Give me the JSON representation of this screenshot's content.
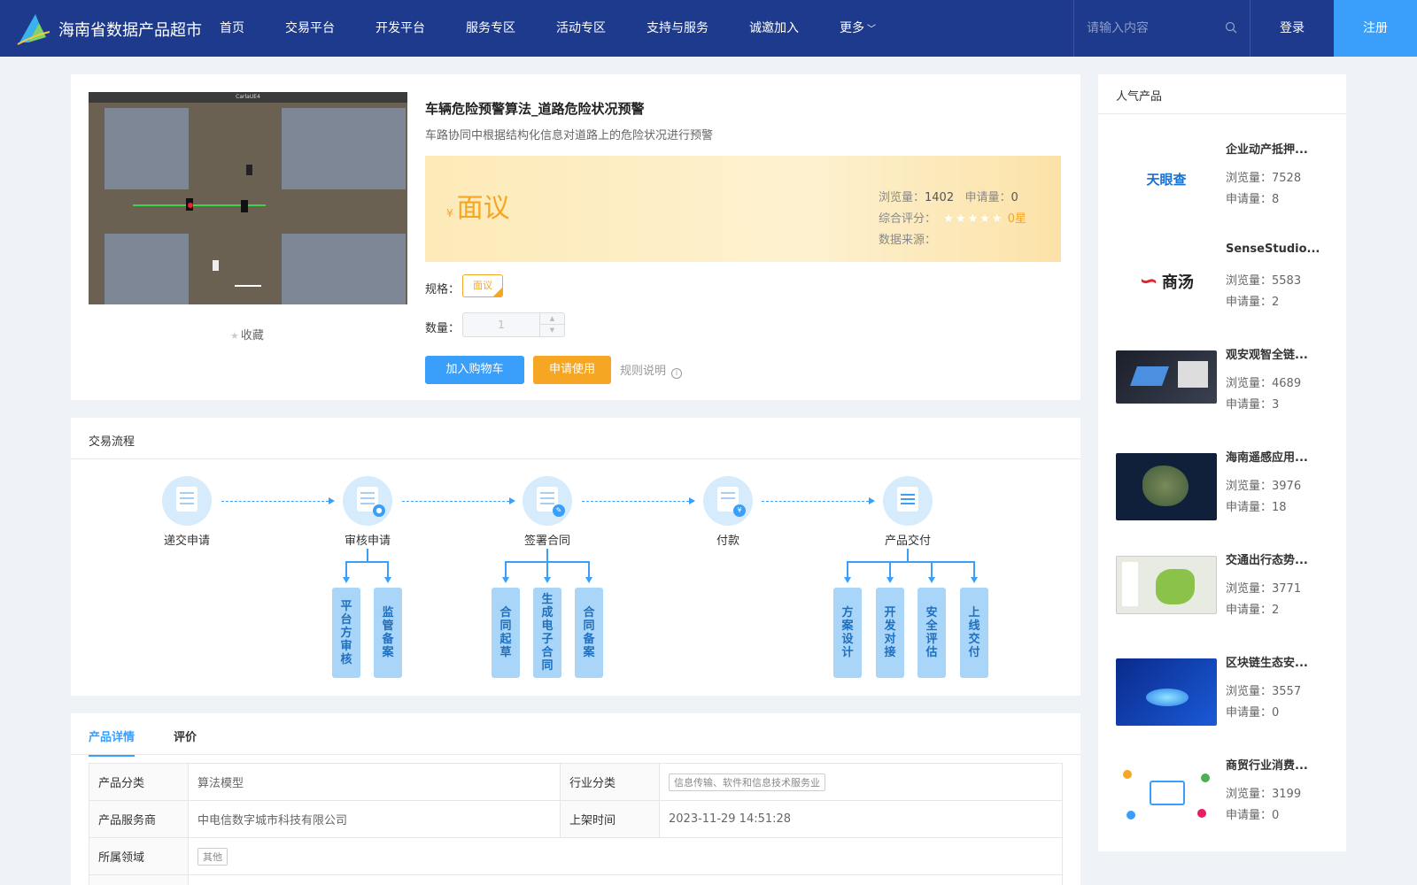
{
  "header": {
    "site_title": "海南省数据产品超市",
    "nav": [
      "首页",
      "交易平台",
      "开发平台",
      "服务专区",
      "活动专区",
      "支持与服务",
      "诚邀加入",
      "更多"
    ],
    "search_placeholder": "请输入内容",
    "login": "登录",
    "register": "注册"
  },
  "product": {
    "title": "车辆危险预警算法_道路危险状况预警",
    "subtitle": "车路协同中根据结构化信息对道路上的危险状况进行预警",
    "currency": "¥",
    "price": "面议",
    "views_label": "浏览量：",
    "views": "1402",
    "applies_label": "申请量：",
    "applies": "0",
    "rating_label": "综合评分：",
    "rating_value": "0星",
    "stars": "★★★★★",
    "source_label": "数据来源：",
    "spec_label": "规格：",
    "spec": "面议",
    "qty_label": "数量：",
    "qty": "1",
    "favorite": "收藏",
    "add_cart": "加入购物车",
    "apply": "申请使用",
    "rules": "规则说明",
    "thumb_window_title": "CarlaUE4"
  },
  "flow": {
    "title": "交易流程",
    "steps": [
      "递交申请",
      "审核申请",
      "签署合同",
      "付款",
      "产品交付"
    ],
    "sub_review": [
      "平台方审核",
      "监管备案"
    ],
    "sub_contract": [
      "合同起草",
      "生成电子合同",
      "合同备案"
    ],
    "sub_delivery": [
      "方案设计",
      "开发对接",
      "安全评估",
      "上线交付"
    ]
  },
  "details": {
    "tabs": [
      "产品详情",
      "评价"
    ],
    "rows": [
      {
        "k1": "产品分类",
        "v1": "算法模型",
        "k2": "行业分类",
        "v2": "信息传输、软件和信息技术服务业"
      },
      {
        "k1": "产品服务商",
        "v1": "中电信数字城市科技有限公司",
        "k2": "上架时间",
        "v2": "2023-11-29 14:51:28"
      },
      {
        "k1": "所属领域",
        "v1": "其他"
      }
    ]
  },
  "popular": {
    "title": "人气产品",
    "items": [
      {
        "name": "企业动产抵押...",
        "views": "浏览量：7528",
        "apps": "申请量：8",
        "logo": "天眼查"
      },
      {
        "name": "SenseStudio...",
        "views": "浏览量：5583",
        "apps": "申请量：2",
        "logo": "商汤"
      },
      {
        "name": "观安观智全链...",
        "views": "浏览量：4689",
        "apps": "申请量：3"
      },
      {
        "name": "海南遥感应用...",
        "views": "浏览量：3976",
        "apps": "申请量：18"
      },
      {
        "name": "交通出行态势...",
        "views": "浏览量：3771",
        "apps": "申请量：2"
      },
      {
        "name": "区块链生态安...",
        "views": "浏览量：3557",
        "apps": "申请量：0"
      },
      {
        "name": "商贸行业消费...",
        "views": "浏览量：3199",
        "apps": "申请量：0"
      }
    ]
  }
}
